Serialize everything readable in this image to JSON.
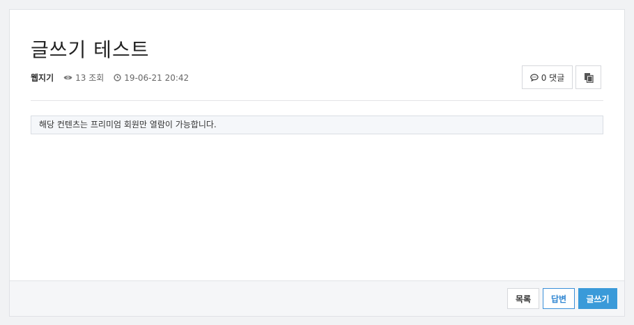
{
  "post": {
    "title": "글쓰기 테스트",
    "author": "웹지기",
    "views": "13 조회",
    "date": "19-06-21 20:42"
  },
  "actions": {
    "comment_label": "0 댓글"
  },
  "notice": {
    "text": "해당 컨텐츠는 프리미엄 회원만 열람이 가능합니다."
  },
  "footer": {
    "list_label": "목록",
    "reply_label": "답변",
    "write_label": "글쓰기"
  },
  "colors": {
    "accent": "#3a9ad9",
    "reply_border": "#3a8fd9"
  },
  "icons": {
    "views": "eye-icon",
    "date": "clock-icon",
    "comment": "comment-icon",
    "copy": "copy-icon"
  }
}
